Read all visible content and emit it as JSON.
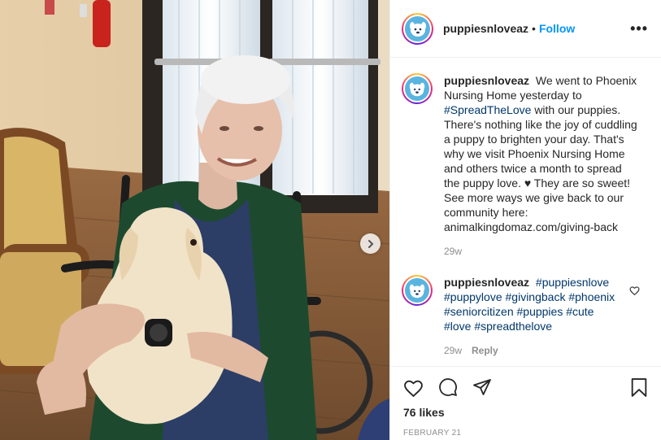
{
  "post": {
    "username": "puppiesnloveaz",
    "follow_label": "Follow",
    "separator": "•",
    "more_label": "•••"
  },
  "caption": {
    "username": "puppiesnloveaz",
    "text_before": "We went to Phoenix Nursing Home yesterday to",
    "hashtag": "#SpreadTheLove",
    "text_after": "with our puppies. There's nothing like the joy of cuddling a puppy to brighten your day. That's why we visit Phoenix Nursing Home and others twice a month to spread the puppy love. ♥ They are so sweet! See more ways we give back to our community here: animalkingdomaz.com/giving-back",
    "time": "29w"
  },
  "comment": {
    "username": "puppiesnloveaz",
    "hashtags": [
      "#puppiesnlove",
      "#puppylove",
      "#givingback",
      "#phoenix",
      "#seniorcitizen",
      "#puppies",
      "#cute",
      "#love",
      "#spreadthelove"
    ],
    "time": "29w",
    "reply_label": "Reply"
  },
  "footer": {
    "likes": "76 likes",
    "date": "FEBRUARY 21"
  },
  "icons": {
    "like": "heart-icon",
    "comment": "comment-icon",
    "share": "paper-plane-icon",
    "save": "bookmark-icon",
    "next": "chevron-right-icon",
    "avatar": "puppy-logo-icon"
  },
  "colors": {
    "follow": "#0095f6",
    "hashtag": "#00376b",
    "muted": "#8e8e8e",
    "text": "#262626"
  }
}
